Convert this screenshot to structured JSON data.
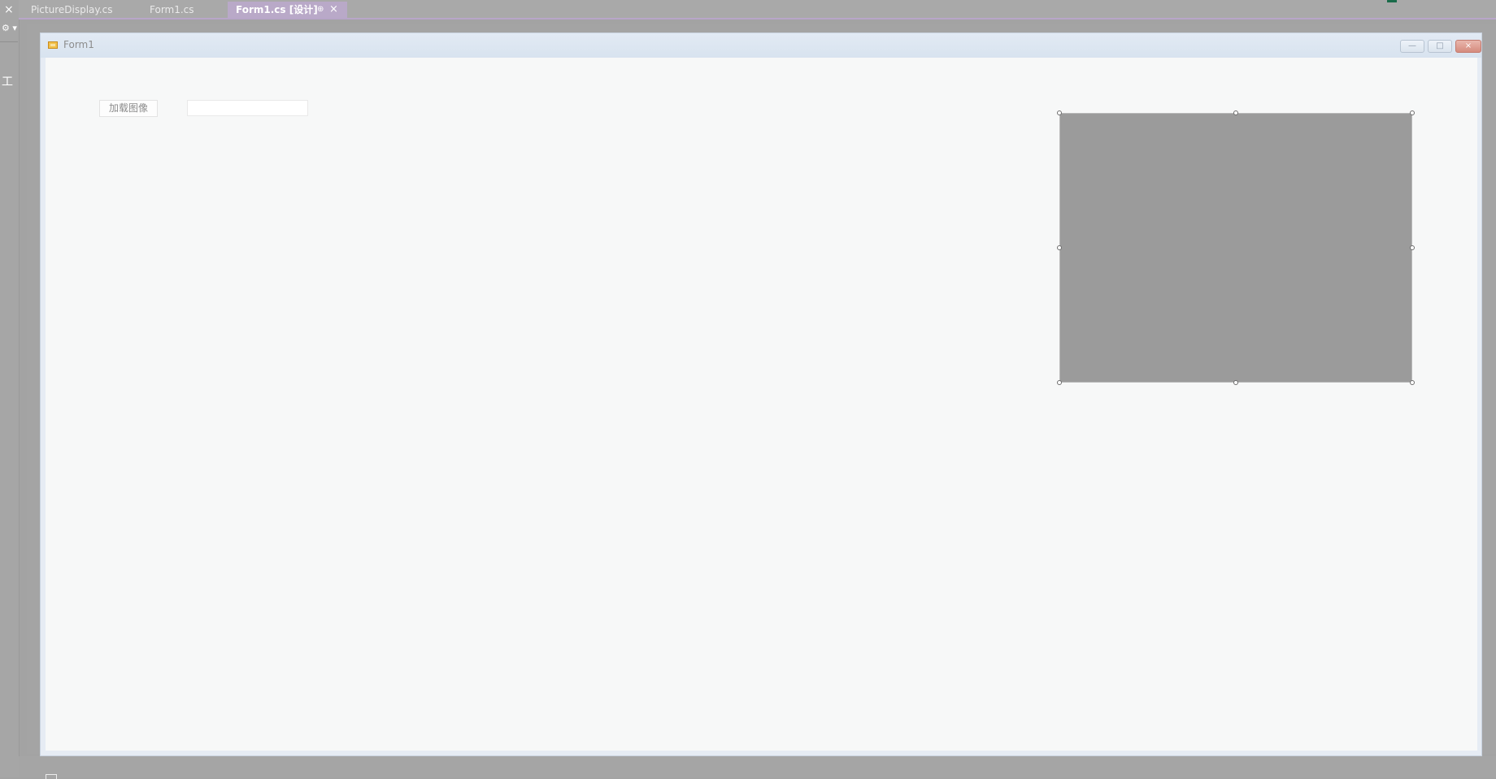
{
  "left_panel": {
    "close_glyph": "×",
    "gear_glyph": "⚙ ▾",
    "tool_glyph": "工"
  },
  "tabs": [
    {
      "label": "PictureDisplay.cs",
      "active": false
    },
    {
      "label": "Form1.cs",
      "active": false
    },
    {
      "label": "Form1.cs [设计]",
      "active": true,
      "pin_glyph": "⊕",
      "close_glyph": "×"
    }
  ],
  "form": {
    "title": "Form1",
    "minimize_glyph": "—",
    "maximize_glyph": "□",
    "close_glyph": "×"
  },
  "controls": {
    "load_button_label": "加载图像",
    "textbox_value": ""
  },
  "picturebox": {
    "background": "#9b9b9b",
    "selected": true
  },
  "colors": {
    "active_tab": "#b9a9c8",
    "ide_background": "#a3a3a3",
    "form_client": "#f7f8f8"
  }
}
